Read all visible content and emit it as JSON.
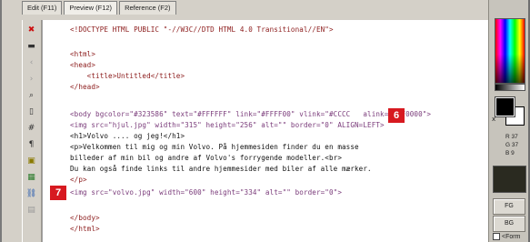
{
  "tabs": [
    {
      "label": "Edit (F11)"
    },
    {
      "label": "Preview (F12)"
    },
    {
      "label": "Reference (F2)"
    }
  ],
  "toolbar_icons": [
    {
      "name": "close-icon",
      "glyph": "✖"
    },
    {
      "name": "save-icon",
      "glyph": "▬"
    },
    {
      "name": "back-icon",
      "glyph": "‹"
    },
    {
      "name": "forward-icon",
      "glyph": "›"
    },
    {
      "name": "search-icon",
      "glyph": "⌕"
    },
    {
      "name": "tag-insert-icon",
      "glyph": "▯"
    },
    {
      "name": "hash-icon",
      "glyph": "#"
    },
    {
      "name": "paragraph-icon",
      "glyph": "¶"
    },
    {
      "name": "image-icon",
      "glyph": "▣"
    },
    {
      "name": "table-icon",
      "glyph": "▦"
    },
    {
      "name": "link-icon",
      "glyph": "⛓"
    },
    {
      "name": "grid-icon",
      "glyph": "▤"
    }
  ],
  "code_lines": [
    {
      "text": "<!DOCTYPE HTML PUBLIC \"-//W3C//DTD HTML 4.0 Transitional//EN\">",
      "kind": "tag"
    },
    {
      "text": "",
      "kind": "txt"
    },
    {
      "text": "<html>",
      "kind": "tag"
    },
    {
      "text": "<head>",
      "kind": "tag"
    },
    {
      "text": "    <title>Untitled</title>",
      "kind": "tag"
    },
    {
      "text": "</head>",
      "kind": "tag"
    },
    {
      "text": "",
      "kind": "txt"
    },
    {
      "text": "<body bgcolor=\"#323586\" text=\"#FFFFFF\" link=\"#FFFF00\" vlink=\"#CCCC   alink=\"#FF0000\">",
      "kind": "attr"
    },
    {
      "text": "<img src=\"hjul.jpg\" width=\"315\" height=\"256\" alt=\"\" border=\"0\" ALIGN=LEFT>",
      "kind": "attr"
    },
    {
      "text": "<h1>Volvo .... og jeg!</h1>",
      "kind": "mixed"
    },
    {
      "text": "<p>Velkommen til mig og min Volvo. På hjemmesiden finder du en masse",
      "kind": "mixed"
    },
    {
      "text": "billeder af min bil og andre af Volvo's forrygende modeller.<br>",
      "kind": "mixed"
    },
    {
      "text": "Du kan også finde links til andre hjemmesider med biler af alle mærker.",
      "kind": "txt"
    },
    {
      "text": "</p>",
      "kind": "tag"
    },
    {
      "text": "<img src=\"volvo.jpg\" width=\"600\" height=\"334\" alt=\"\" border=\"0\">",
      "kind": "attr"
    },
    {
      "text": "",
      "kind": "txt"
    },
    {
      "text": "</body>",
      "kind": "tag"
    },
    {
      "text": "</html>",
      "kind": "tag"
    }
  ],
  "markers": [
    {
      "label": "6"
    },
    {
      "label": "7"
    }
  ],
  "color_panel": {
    "swap_label": "x",
    "r": "R 37",
    "g": "G 37",
    "b": "B 9",
    "fg_button": "FG",
    "bg_button": "BG",
    "check_label": "<Form"
  },
  "colors": {
    "tag": "#8b1a1a",
    "attr": "#7a3b7a",
    "marker": "#d71920",
    "panel_dark": "#2a2a20"
  }
}
